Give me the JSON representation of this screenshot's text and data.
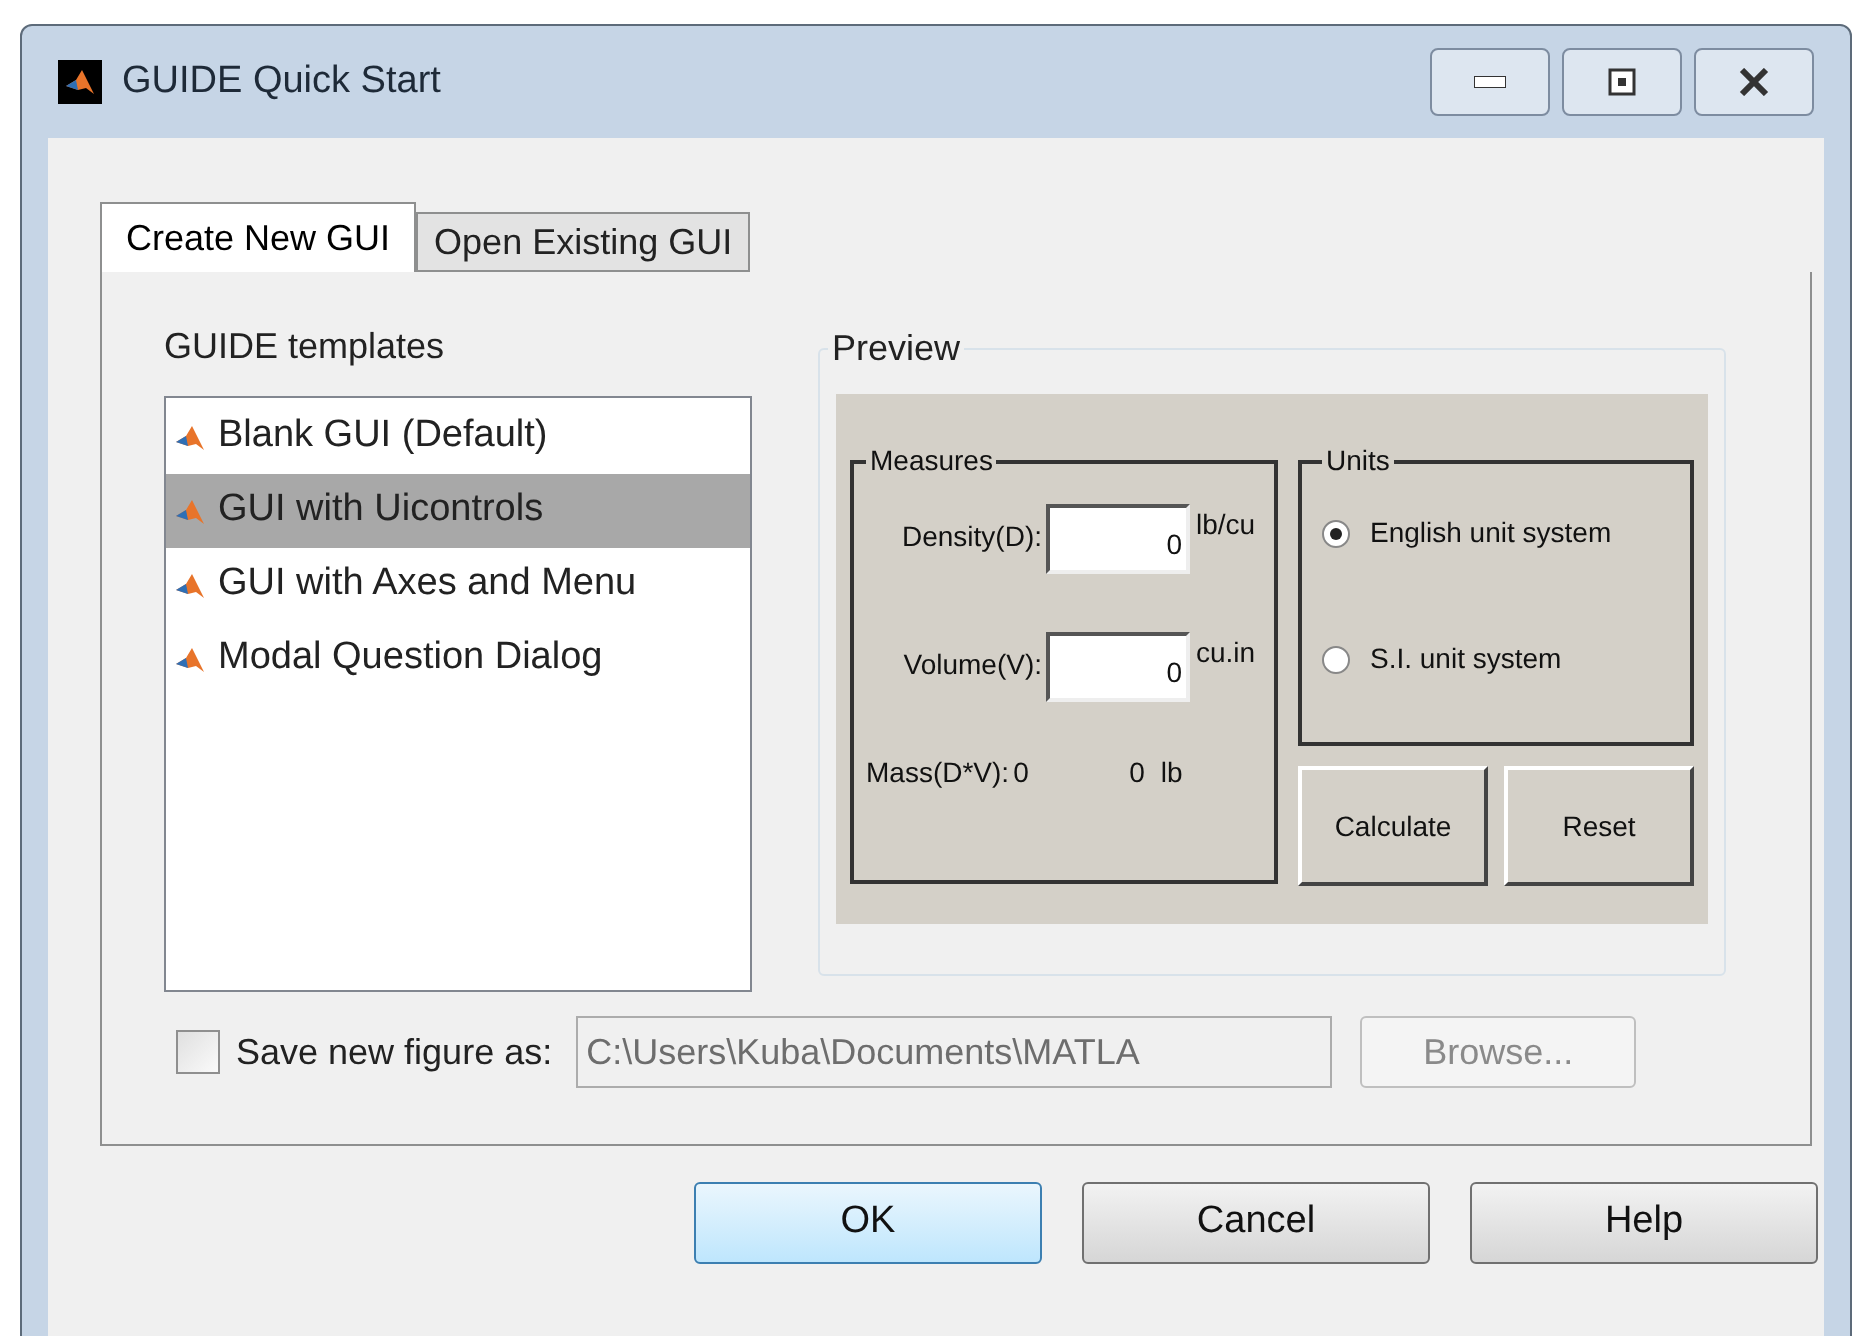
{
  "window": {
    "title": "GUIDE Quick Start"
  },
  "tabs": [
    {
      "label": "Create New GUI",
      "selected": true
    },
    {
      "label": "Open Existing GUI",
      "selected": false
    }
  ],
  "templates": {
    "label": "GUIDE templates",
    "items": [
      {
        "label": "Blank GUI (Default)",
        "selected": false
      },
      {
        "label": "GUI with Uicontrols",
        "selected": true
      },
      {
        "label": "GUI with Axes and Menu",
        "selected": false
      },
      {
        "label": "Modal Question Dialog",
        "selected": false
      }
    ]
  },
  "preview": {
    "title": "Preview",
    "measures": {
      "title": "Measures",
      "rows": [
        {
          "label": "Density(D):",
          "value": "0",
          "unit": "lb/cu"
        },
        {
          "label": "Volume(V):",
          "value": "0",
          "unit": "cu.in"
        }
      ],
      "mass": {
        "label": "Mass(D*V):",
        "value": "0",
        "result": "0",
        "unit": "lb"
      }
    },
    "units": {
      "title": "Units",
      "options": [
        {
          "label": "English unit system",
          "selected": true
        },
        {
          "label": "S.I. unit system",
          "selected": false
        }
      ]
    },
    "buttons": [
      "Calculate",
      "Reset"
    ]
  },
  "save": {
    "label": "Save new figure as:",
    "checked": false,
    "path": "C:\\Users\\Kuba\\Documents\\MATLA",
    "disabled": true
  },
  "browse": {
    "label": "Browse...",
    "disabled": true
  },
  "buttons": [
    {
      "label": "OK",
      "default": true
    },
    {
      "label": "Cancel",
      "default": false
    },
    {
      "label": "Help",
      "default": false
    }
  ]
}
